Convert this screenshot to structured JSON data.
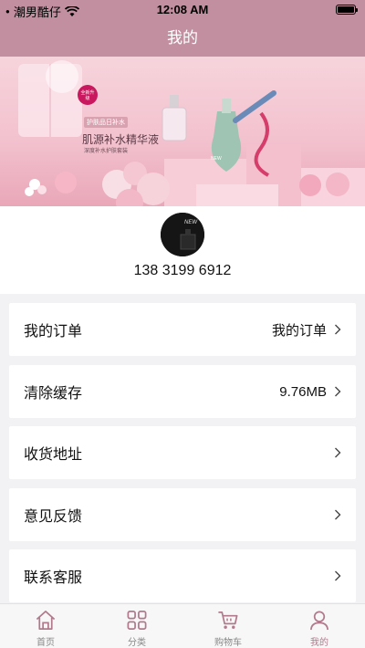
{
  "status": {
    "carrier": "潮男酷仔",
    "time": "12:08 AM"
  },
  "header": {
    "title": "我的"
  },
  "banner": {
    "badge": "全新升级",
    "tagline": "护肤品日补水",
    "headline": "肌源补水精华液",
    "subline": "深度补水护肤套装",
    "product_mark": "NEW"
  },
  "profile": {
    "avatar_mark": "NEW",
    "phone": "138 3199 6912"
  },
  "menu": [
    {
      "label": "我的订单",
      "value": "我的订单"
    },
    {
      "label": "清除缓存",
      "value": "9.76MB"
    },
    {
      "label": "收货地址",
      "value": ""
    },
    {
      "label": "意见反馈",
      "value": ""
    },
    {
      "label": "联系客服",
      "value": ""
    }
  ],
  "tabs": [
    {
      "label": "首页",
      "icon": "home-icon",
      "active": false
    },
    {
      "label": "分类",
      "icon": "grid-icon",
      "active": false
    },
    {
      "label": "购物车",
      "icon": "cart-icon",
      "active": false
    },
    {
      "label": "我的",
      "icon": "user-icon",
      "active": true
    }
  ],
  "colors": {
    "theme": "#c28fa0",
    "tab_active": "#b07a8c",
    "tab_inactive": "#888888",
    "background": "#f2f2f4"
  }
}
